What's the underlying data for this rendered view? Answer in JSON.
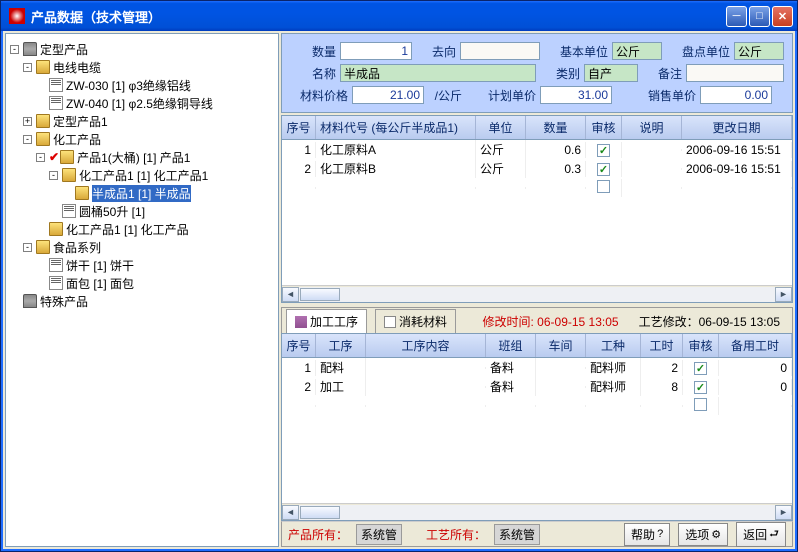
{
  "title": "产品数据（技术管理）",
  "tree": {
    "n1": {
      "pm": "-",
      "label": "定型产品"
    },
    "n1_1": {
      "pm": "-",
      "label": "电线电缆"
    },
    "n1_1_1": {
      "label": "ZW-030  [1] φ3绝缘铝线"
    },
    "n1_1_2": {
      "label": "ZW-040  [1] φ2.5绝缘铜导线"
    },
    "n1_2": {
      "pm": "+",
      "label": "定型产品1"
    },
    "n1_3": {
      "pm": "-",
      "label": "化工产品"
    },
    "n1_3_1": {
      "pm": "-",
      "label": "产品1(大桶)  [1] 产品1"
    },
    "n1_3_1_1": {
      "pm": "-",
      "label": "化工产品1  [1] 化工产品1"
    },
    "n1_3_1_1_1": {
      "label": "半成品1  [1] 半成品"
    },
    "n1_3_1_2": {
      "label": "圆桶50升  [1]"
    },
    "n1_3_2": {
      "label": "化工产品1  [1] 化工产品"
    },
    "n1_4": {
      "pm": "-",
      "label": "食品系列"
    },
    "n1_4_1": {
      "label": "饼干  [1] 饼干"
    },
    "n1_4_2": {
      "label": "面包  [1] 面包"
    },
    "n2": {
      "label": "特殊产品"
    }
  },
  "form": {
    "qty_lbl": "数量",
    "qty": "1",
    "dir_lbl": "去向",
    "dir": "",
    "base_unit_lbl": "基本单位",
    "base_unit": "公斤",
    "inv_unit_lbl": "盘点单位",
    "inv_unit": "公斤",
    "name_lbl": "名称",
    "name": "半成品",
    "cat_lbl": "类别",
    "cat": "自产",
    "note_lbl": "备注",
    "note": "",
    "matprice_lbl": "材料价格",
    "matprice": "21.00",
    "matprice_u": "/公斤",
    "planprice_lbl": "计划单价",
    "planprice": "31.00",
    "saleprice_lbl": "销售单价",
    "saleprice": "0.00"
  },
  "tbl1": {
    "h": {
      "seq": "序号",
      "code": "材料代号 (每公斤半成品1)",
      "unit": "单位",
      "qty": "数量",
      "ok": "审核",
      "desc": "说明",
      "mod": "更改日期"
    },
    "r": [
      {
        "seq": "1",
        "code": "化工原料A",
        "unit": "公斤",
        "qty": "0.6",
        "ok": true,
        "desc": "",
        "mod": "2006-09-16 15:51"
      },
      {
        "seq": "2",
        "code": "化工原料B",
        "unit": "公斤",
        "qty": "0.3",
        "ok": true,
        "desc": "",
        "mod": "2006-09-16 15:51"
      }
    ]
  },
  "tabs": {
    "t1": "加工工序",
    "t2": "消耗材料",
    "mod_lbl": "修改时间:",
    "mod_val": "06-09-15 13:05",
    "craft_lbl": "工艺修改：",
    "craft_val": "06-09-15 13:05"
  },
  "tbl2": {
    "h": {
      "seq": "序号",
      "proc": "工序",
      "content": "工序内容",
      "team": "班组",
      "shop": "车间",
      "type": "工种",
      "hrs": "工时",
      "ok": "审核",
      "spare": "备用工时"
    },
    "r": [
      {
        "seq": "1",
        "proc": "配料",
        "content": "",
        "team": "备料",
        "shop": "",
        "type": "配料师",
        "hrs": "2",
        "ok": true,
        "spare": "0"
      },
      {
        "seq": "2",
        "proc": "加工",
        "content": "",
        "team": "备料",
        "shop": "",
        "type": "配料师",
        "hrs": "8",
        "ok": true,
        "spare": "0"
      }
    ]
  },
  "footer": {
    "owner_lbl": "产品所有：",
    "owner": "系统管",
    "craft_owner_lbl": "工艺所有：",
    "craft_owner": "系统管",
    "help": "帮助",
    "opt": "选项",
    "back": "返回"
  }
}
